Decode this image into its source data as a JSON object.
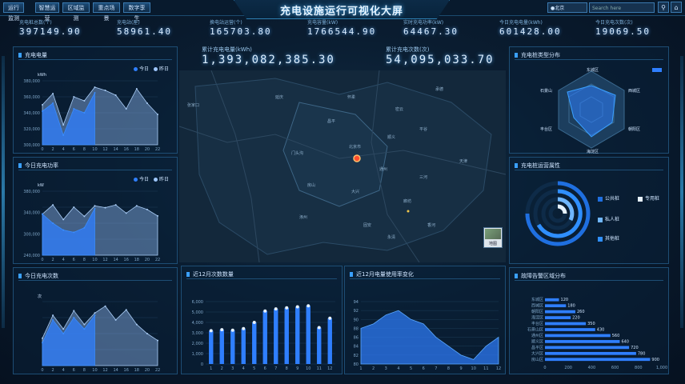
{
  "nav": {
    "items": [
      "运行监测",
      "智慧运营",
      "区域监测",
      "重点场景",
      "数字孪生"
    ]
  },
  "title": "充电设施运行可视化大屏",
  "top_right": {
    "area_label": "●北京",
    "search_placeholder": "Search here"
  },
  "stats": [
    {
      "label": "充电桩总数(个)",
      "value": "397149.90"
    },
    {
      "label": "充电站(座)",
      "value": "58961.40"
    },
    {
      "label": "换电站运营(个)",
      "value": "165703.80"
    },
    {
      "label": "充电容量(kW)",
      "value": "1766544.90"
    },
    {
      "label": "实时充电功率(kW)",
      "value": "64467.30"
    },
    {
      "label": "今日充电电量(kWh)",
      "value": "601428.00"
    },
    {
      "label": "今日充电次数(次)",
      "value": "19069.50"
    }
  ],
  "big_stats": [
    {
      "label": "累计充电电量(kWh)",
      "value": "1,393,082,385.30"
    },
    {
      "label": "累计充电次数(次)",
      "value": "54,095,033.70"
    }
  ],
  "panel1": {
    "title": "充电电量",
    "unit": "kWh",
    "legend_today": "今日",
    "legend_yesterday": "昨日"
  },
  "panel2": {
    "title": "今日充电功率",
    "unit": "kW",
    "legend_today": "今日",
    "legend_yesterday": "昨日"
  },
  "panel3": {
    "title": "今日充电次数",
    "unit": "次"
  },
  "panel4": {
    "title": "近12月次数数量"
  },
  "panel5": {
    "title": "近12月电量使用率变化"
  },
  "panel6": {
    "title": "充电桩类型分布"
  },
  "panel7": {
    "title": "充电桩运营属性"
  },
  "panel8": {
    "title": "故障告警区域分布"
  },
  "ring_legend": [
    "公共桩",
    "专用桩",
    "私人桩",
    "其他桩"
  ],
  "radar_labels": [
    "东城区",
    "西城区",
    "朝阳区",
    "海淀区",
    "丰台区",
    "石景山"
  ],
  "map_labels": [
    "延庆",
    "怀柔",
    "密云",
    "昌平",
    "顺义",
    "平谷",
    "门头沟",
    "北京市",
    "通州",
    "房山",
    "大兴",
    "廊坊",
    "涿州",
    "三河",
    "固安",
    "香河",
    "永清",
    "张家口",
    "承德",
    "天津"
  ],
  "map_mini_label": "地图",
  "chart_data": [
    {
      "type": "area",
      "title": "充电电量",
      "ylabel": "kWh",
      "x": [
        0,
        2,
        4,
        6,
        8,
        10,
        12,
        14,
        16,
        18,
        20,
        22
      ],
      "ylim": [
        300000,
        380000
      ],
      "yticks": [
        "380,000",
        "360,000",
        "340,000",
        "320,000",
        "300,000"
      ],
      "series": [
        {
          "name": "今日",
          "values": [
            342000,
            352000,
            312000,
            345000,
            340000,
            365000
          ]
        },
        {
          "name": "昨日",
          "values": [
            350000,
            364000,
            325000,
            360000,
            355000,
            372000,
            368000,
            362000,
            345000,
            370000,
            352000,
            338000
          ]
        }
      ]
    },
    {
      "type": "area",
      "title": "今日充电功率",
      "ylabel": "kW",
      "x": [
        0,
        2,
        4,
        6,
        8,
        10,
        12,
        14,
        16,
        18,
        20,
        22
      ],
      "ylim": [
        240000,
        380000
      ],
      "yticks": [
        "380,000",
        "340,000",
        "300,000",
        "240,000"
      ],
      "series": [
        {
          "name": "今日",
          "values": [
            330000,
            310000,
            295000,
            290000,
            300000,
            342000
          ]
        },
        {
          "name": "昨日",
          "values": [
            330000,
            350000,
            318000,
            345000,
            325000,
            348000,
            344000,
            350000,
            332000,
            348000,
            340000,
            326000
          ]
        }
      ]
    },
    {
      "type": "area",
      "title": "今日充电次数",
      "ylabel": "次",
      "x": [
        0,
        2,
        4,
        6,
        8,
        10,
        12,
        14,
        16,
        18,
        20,
        22
      ],
      "ylim": [
        250000,
        390000
      ],
      "series": [
        {
          "name": "今日",
          "values": [
            300000,
            350000,
            320000,
            355000,
            330000,
            360000
          ]
        },
        {
          "name": "昨日",
          "values": [
            310000,
            360000,
            330000,
            370000,
            340000,
            365000,
            380000,
            350000,
            372000,
            340000,
            320000,
            305000
          ]
        }
      ]
    },
    {
      "type": "bar",
      "title": "近12月次数数量",
      "categories": [
        "1",
        "2",
        "3",
        "4",
        "5",
        "6",
        "7",
        "8",
        "9",
        "10",
        "11",
        "12"
      ],
      "values": [
        3200,
        3300,
        3250,
        3400,
        4000,
        5100,
        5300,
        5400,
        5500,
        5600,
        3500,
        4400
      ],
      "yticks": [
        "6,000",
        "5,000",
        "4,000",
        "3,000",
        "2,000",
        "1,000",
        "0"
      ],
      "ylim": [
        0,
        6000
      ]
    },
    {
      "type": "area",
      "title": "近12月电量使用率变化",
      "ylabel": "%",
      "categories": [
        "1",
        "2",
        "3",
        "4",
        "5",
        "6",
        "7",
        "8",
        "9",
        "10",
        "11",
        "12"
      ],
      "values": [
        88,
        89,
        91,
        92,
        90,
        89,
        86,
        84,
        82,
        81,
        84,
        86
      ],
      "yticks": [
        "94",
        "92",
        "90",
        "88",
        "86",
        "84",
        "82",
        "80"
      ],
      "ylim": [
        80,
        94
      ]
    },
    {
      "type": "bar",
      "title": "故障告警区域分布",
      "categories": [
        "东城区",
        "西城区",
        "朝阳区",
        "海淀区",
        "丰台区",
        "石景山区",
        "通州区",
        "顺义区",
        "昌平区",
        "大兴区",
        "房山区"
      ],
      "values": [
        120,
        180,
        260,
        220,
        350,
        430,
        560,
        640,
        720,
        780,
        900
      ],
      "xticks": [
        "0",
        "200",
        "400",
        "600",
        "800",
        "1,000"
      ],
      "xlim": [
        0,
        1000
      ]
    }
  ]
}
